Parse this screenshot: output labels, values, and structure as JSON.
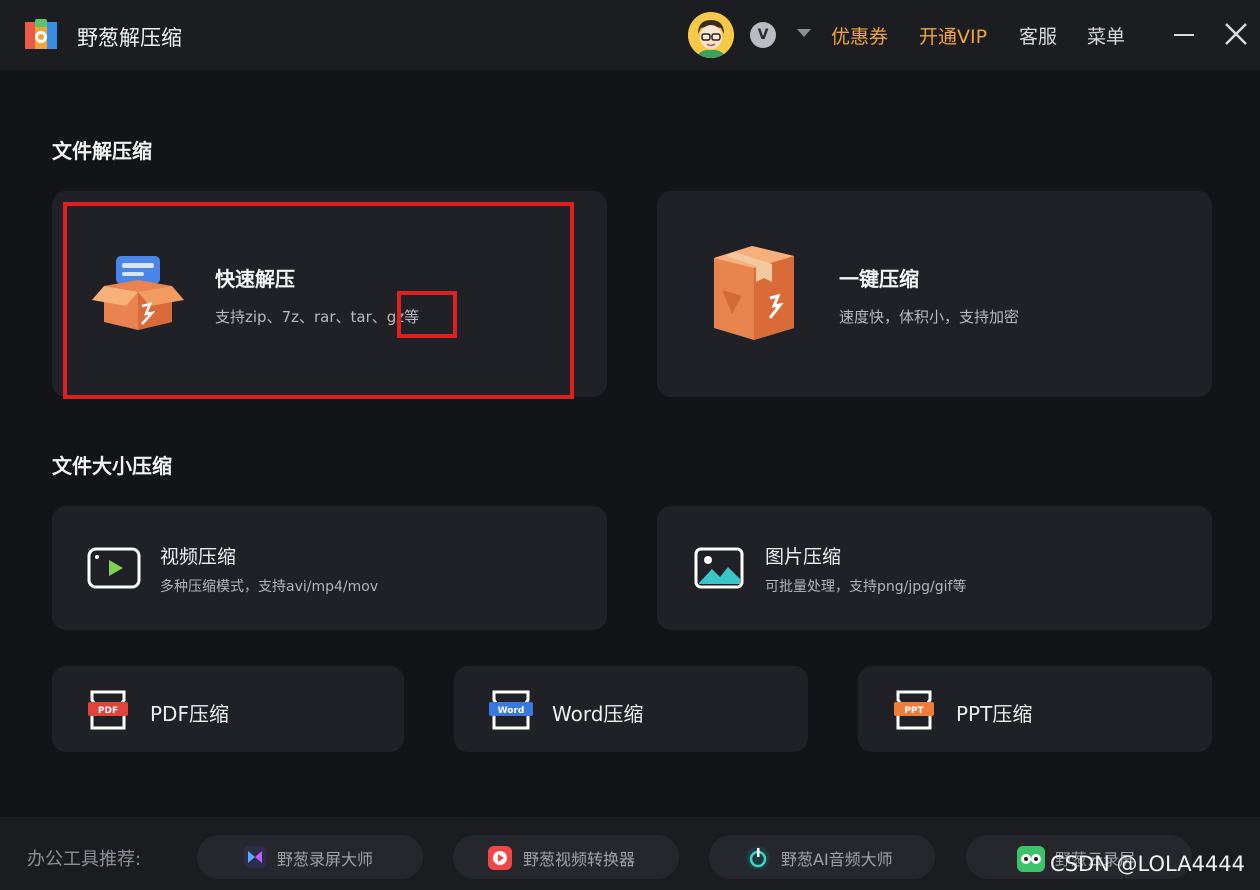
{
  "app": {
    "title": "野葱解压缩"
  },
  "header": {
    "coupon": "优惠券",
    "vip": "开通VIP",
    "service": "客服",
    "menu": "菜单",
    "vip_badge_letter": "V"
  },
  "sections": {
    "extract": "文件解压缩",
    "compress": "文件大小压缩"
  },
  "quick_extract": {
    "title": "快速解压",
    "desc": "支持zip、7z、rar、tar、gz等"
  },
  "one_click": {
    "title": "一键压缩",
    "desc": "速度快，体积小，支持加密"
  },
  "video": {
    "title": "视频压缩",
    "desc": "多种压缩模式，支持avi/mp4/mov"
  },
  "image": {
    "title": "图片压缩",
    "desc": "可批量处理，支持png/jpg/gif等"
  },
  "pdf": {
    "title": "PDF压缩",
    "icon_label": "PDF"
  },
  "word": {
    "title": "Word压缩",
    "icon_label": "Word"
  },
  "ppt": {
    "title": "PPT压缩",
    "icon_label": "PPT"
  },
  "recommend": {
    "label": "办公工具推荐:",
    "items": [
      "野葱录屏大师",
      "野葱视频转换器",
      "野葱AI音频大师",
      "野葱云录屏"
    ]
  },
  "watermark": "CSDN @LOLA4444",
  "colors": {
    "accent": "#f2a53a",
    "highlight": "#e02020",
    "bg": "#131417",
    "card": "#1f2126"
  }
}
